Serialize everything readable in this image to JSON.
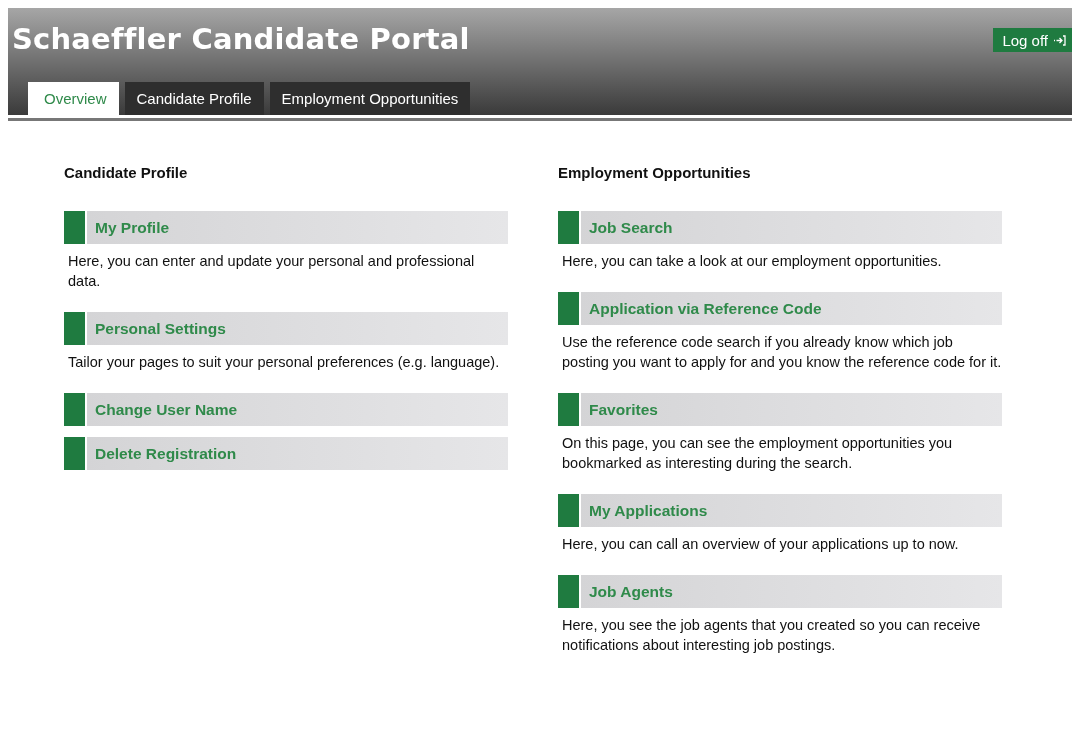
{
  "header": {
    "title": "Schaeffler Candidate Portal",
    "logoff": "Log off"
  },
  "tabs": [
    {
      "label": "Overview",
      "selected": true
    },
    {
      "label": "Candidate Profile",
      "selected": false
    },
    {
      "label": "Employment Opportunities",
      "selected": false
    }
  ],
  "columns": [
    {
      "heading": "Candidate Profile",
      "items": [
        {
          "title": "My Profile",
          "description": "Here, you can enter and update your personal and professional data."
        },
        {
          "title": "Personal Settings",
          "description": "Tailor your pages to suit your personal preferences (e.g. language)."
        },
        {
          "title": "Change User Name"
        },
        {
          "title": "Delete Registration"
        }
      ]
    },
    {
      "heading": "Employment Opportunities",
      "items": [
        {
          "title": "Job Search",
          "description": "Here, you can take a look at our employment opportunities."
        },
        {
          "title": "Application via Reference Code",
          "description": "Use the reference code search if you already know which job posting you want to apply for and you know the reference code for it."
        },
        {
          "title": "Favorites",
          "description": "On this page, you can see the employment opportunities you bookmarked as interesting during the search."
        },
        {
          "title": "My Applications",
          "description": "Here, you can call an overview of your applications up to now."
        },
        {
          "title": "Job Agents",
          "description": "Here, you see the job agents that you created so you can receive notifications about interesting job postings."
        }
      ]
    }
  ]
}
